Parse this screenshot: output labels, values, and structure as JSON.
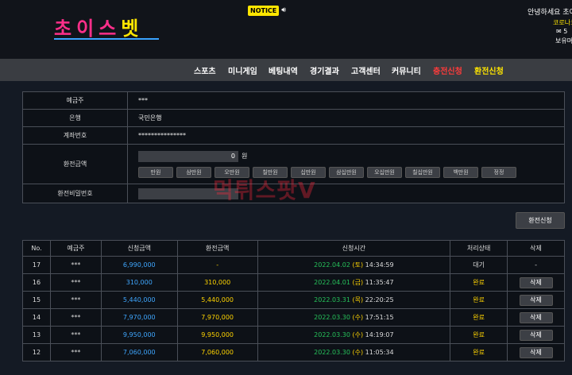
{
  "header": {
    "logo_part1": "초이스",
    "logo_part2": "벳",
    "notice_label": "NOTICE",
    "greeting": "안녕하세요 초이",
    "corona": "코로나코",
    "mail_label": "5",
    "hold_label": "보유머"
  },
  "nav": {
    "items": [
      {
        "label": "스포츠"
      },
      {
        "label": "미니게임"
      },
      {
        "label": "베팅내역"
      },
      {
        "label": "경기결과"
      },
      {
        "label": "고객센터"
      },
      {
        "label": "커뮤니티"
      },
      {
        "label": "충전신청"
      },
      {
        "label": "환전신청"
      }
    ]
  },
  "form": {
    "holder_label": "예금주",
    "holder_value": "***",
    "bank_label": "은행",
    "bank_value": "국민은행",
    "account_label": "계좌번호",
    "account_value": "***************",
    "amount_label": "환전금액",
    "amount_value": "0",
    "amount_unit": "원",
    "amount_buttons": [
      "만원",
      "삼만원",
      "오만원",
      "칠만원",
      "십만원",
      "삼십만원",
      "오십만원",
      "칠십만원",
      "백만원",
      "정정"
    ],
    "password_label": "환전비밀번호",
    "submit_label": "환전신청"
  },
  "watermark": "먹튀스팟V",
  "history": {
    "headers": [
      "No.",
      "예금주",
      "신청금액",
      "환전금액",
      "신청시간",
      "처리상태",
      "삭제"
    ],
    "rows": [
      {
        "no": "17",
        "holder": "***",
        "request": "6,990,000",
        "exchange": "-",
        "date": "2022.04.02",
        "day": "(토)",
        "time": "14:34:59",
        "status": "대기",
        "delete": "-"
      },
      {
        "no": "16",
        "holder": "***",
        "request": "310,000",
        "exchange": "310,000",
        "date": "2022.04.01",
        "day": "(금)",
        "time": "11:35:47",
        "status": "완료",
        "delete": "삭제"
      },
      {
        "no": "15",
        "holder": "***",
        "request": "5,440,000",
        "exchange": "5,440,000",
        "date": "2022.03.31",
        "day": "(목)",
        "time": "22:20:25",
        "status": "완료",
        "delete": "삭제"
      },
      {
        "no": "14",
        "holder": "***",
        "request": "7,970,000",
        "exchange": "7,970,000",
        "date": "2022.03.30",
        "day": "(수)",
        "time": "17:51:15",
        "status": "완료",
        "delete": "삭제"
      },
      {
        "no": "13",
        "holder": "***",
        "request": "9,950,000",
        "exchange": "9,950,000",
        "date": "2022.03.30",
        "day": "(수)",
        "time": "14:19:07",
        "status": "완료",
        "delete": "삭제"
      },
      {
        "no": "12",
        "holder": "***",
        "request": "7,060,000",
        "exchange": "7,060,000",
        "date": "2022.03.30",
        "day": "(수)",
        "time": "11:05:34",
        "status": "완료",
        "delete": "삭제"
      }
    ]
  },
  "colors": {
    "nav_charge": "#ff3b3b",
    "nav_exchange": "#ffe600"
  }
}
